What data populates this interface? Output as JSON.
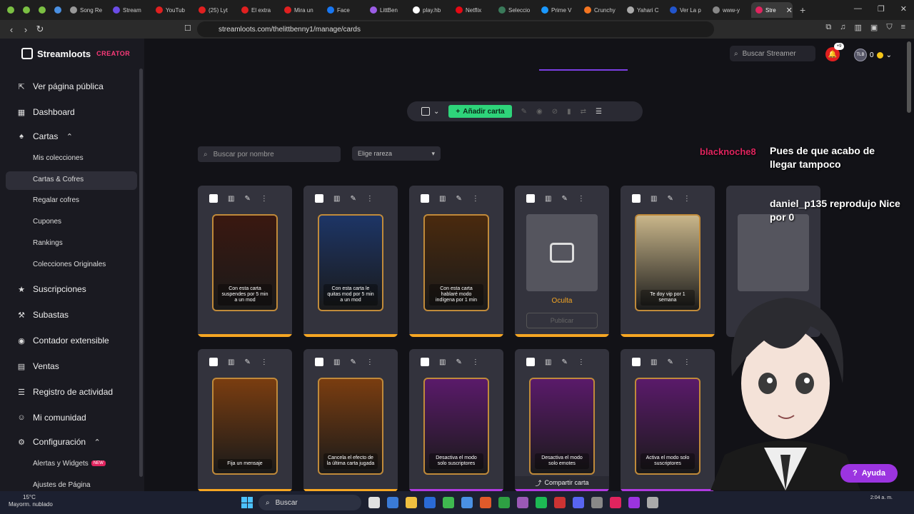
{
  "browser": {
    "tabs": [
      {
        "label": "",
        "color": "#7bc043"
      },
      {
        "label": "",
        "color": "#7bc043"
      },
      {
        "label": "",
        "color": "#7bc043"
      },
      {
        "label": "",
        "color": "#4a90e2"
      },
      {
        "label": "Song Re",
        "color": "#999999"
      },
      {
        "label": "Stream",
        "color": "#6b4ce6"
      },
      {
        "label": "YouTub",
        "color": "#e02020"
      },
      {
        "label": "(25) Lyt",
        "color": "#e02020"
      },
      {
        "label": "El extra",
        "color": "#e02020"
      },
      {
        "label": "Mira un",
        "color": "#e02020"
      },
      {
        "label": "Face",
        "color": "#1877f2"
      },
      {
        "label": "LittBen",
        "color": "#9b5de5"
      },
      {
        "label": "play.hb",
        "color": "#ffffff"
      },
      {
        "label": "Netflix",
        "color": "#e50914"
      },
      {
        "label": "Seleccio",
        "color": "#3a7a5a"
      },
      {
        "label": "Prime V",
        "color": "#1a98ff"
      },
      {
        "label": "Crunchy",
        "color": "#f47521"
      },
      {
        "label": "Yahari C",
        "color": "#aaaaaa"
      },
      {
        "label": "Ver La p",
        "color": "#2255cc"
      },
      {
        "label": "www-y",
        "color": "#888888"
      },
      {
        "label": "Stre",
        "color": "#e0245e",
        "active": true
      }
    ],
    "url": "streamloots.com/thelittbenny1/manage/cards"
  },
  "header": {
    "brand": "Streamloots",
    "brand_suffix": "CREATOR",
    "search_placeholder": "Buscar Streamer",
    "bell_badge": "+9",
    "user_initials": "TLB",
    "coins": "0"
  },
  "sidebar": {
    "items": [
      {
        "label": "Ver página pública",
        "icon": "external-link-icon"
      },
      {
        "label": "Dashboard",
        "icon": "grid-icon"
      },
      {
        "label": "Cartas",
        "icon": "cards-icon"
      },
      {
        "label": "Suscripciones",
        "icon": "star-icon"
      },
      {
        "label": "Subastas",
        "icon": "gavel-icon"
      },
      {
        "label": "Contador extensible",
        "icon": "counter-icon"
      },
      {
        "label": "Ventas",
        "icon": "sales-icon"
      },
      {
        "label": "Registro de actividad",
        "icon": "activity-icon"
      },
      {
        "label": "Mi comunidad",
        "icon": "community-icon"
      },
      {
        "label": "Configuración",
        "icon": "gear-icon"
      }
    ],
    "cartas_sub": [
      "Mis colecciones",
      "Cartas & Cofres",
      "Regalar cofres",
      "Cupones",
      "Rankings",
      "Colecciones Originales"
    ],
    "config_sub": [
      "Alertas y Widgets",
      "Ajustes de Página"
    ],
    "new_badge": "NEW"
  },
  "toolbar": {
    "add_label": "Añadir carta"
  },
  "filters": {
    "search_placeholder": "Buscar por nombre",
    "rarity_placeholder": "Elige rareza"
  },
  "cards_row1": [
    {
      "text": "Con esta carta suspendes por 5 min a un mod",
      "bg": "#3a1810",
      "bar": "#f5a623"
    },
    {
      "text": "Con esta carta le quitas mod por 5 min a un mod",
      "bg": "#1d3566",
      "bar": "#f5a623"
    },
    {
      "text": "Con esta carta hablaré modo indígena por 1 min",
      "bg": "#4a2a0e",
      "bar": "#f5a623"
    },
    {
      "text": "",
      "bg": "#55555e",
      "bar": "#f5a623",
      "hidden": true
    },
    {
      "text": "Te doy vip por 1 semana",
      "bg": "#c9b68a",
      "bar": "#f5a623"
    }
  ],
  "cards_row2": [
    {
      "text": "Fija un mensaje",
      "bg": "#7a3d10",
      "bar": "#f5a623"
    },
    {
      "text": "Cancela el efecto de la última carta jugada",
      "bg": "#7a3d10",
      "bar": "#f5a623"
    },
    {
      "text": "Desactiva el modo solo suscriptores",
      "bg": "#5a1a6a",
      "bar": "#b03ae0"
    },
    {
      "text": "Desactiva el modo solo emotes",
      "bg": "#5a1a6a",
      "bar": "#b03ae0"
    },
    {
      "text": "Activa el modo solo suscriptores",
      "bg": "#5a1a6a",
      "bar": "#b03ae0"
    }
  ],
  "hidden_card": {
    "status": "Oculta",
    "publish": "Publicar"
  },
  "share_label": "Compartir carta",
  "chat": {
    "user1": "blacknoche8",
    "msg1": "Pues de que acabo de llegar tampoco",
    "msg2": "daniel_p135 reprodujo Nice por 0"
  },
  "help_label": "Ayuda",
  "taskbar": {
    "temp": "15°C",
    "weather": "Mayorm. nublado",
    "search": "Buscar",
    "time": "2:04 a. m."
  }
}
